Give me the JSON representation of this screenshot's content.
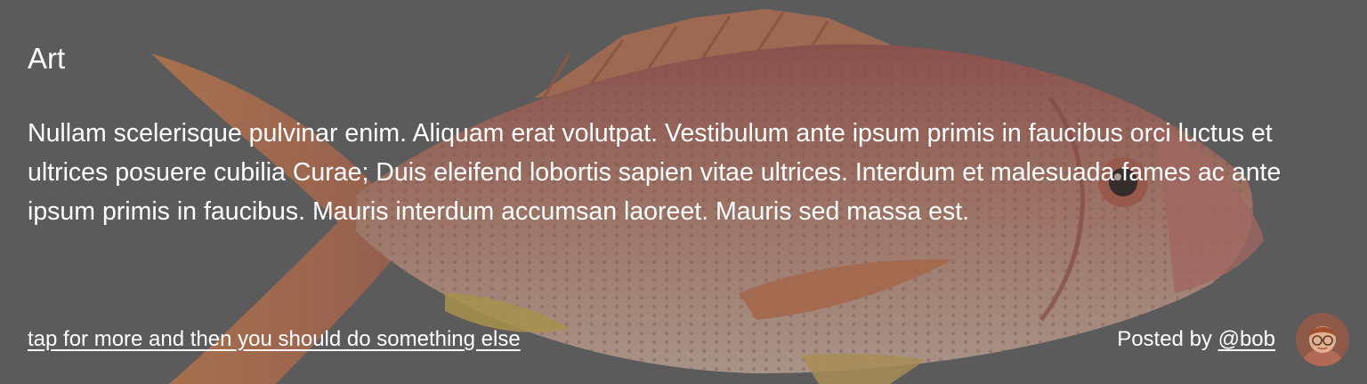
{
  "card": {
    "title": "Art",
    "body": "Nullam scelerisque pulvinar enim. Aliquam erat volutpat. Vestibulum ante ipsum primis in faucibus orci luctus et ultrices posuere cubilia Curae; Duis eleifend lobortis sapien vitae ultrices. Interdum et malesuada fames ac ante ipsum primis in faucibus. Mauris interdum accumsan laoreet. Mauris sed massa est.",
    "more_link": "tap for more and then you should do something else",
    "posted_by_prefix": "Posted by ",
    "author_handle": "@bob",
    "background_image": "fish-image",
    "avatar_image": "avatar"
  },
  "colors": {
    "overlay": "#626262",
    "text": "#ffffff",
    "fish_body": "#c86a55",
    "fin": "#e07a4a"
  }
}
